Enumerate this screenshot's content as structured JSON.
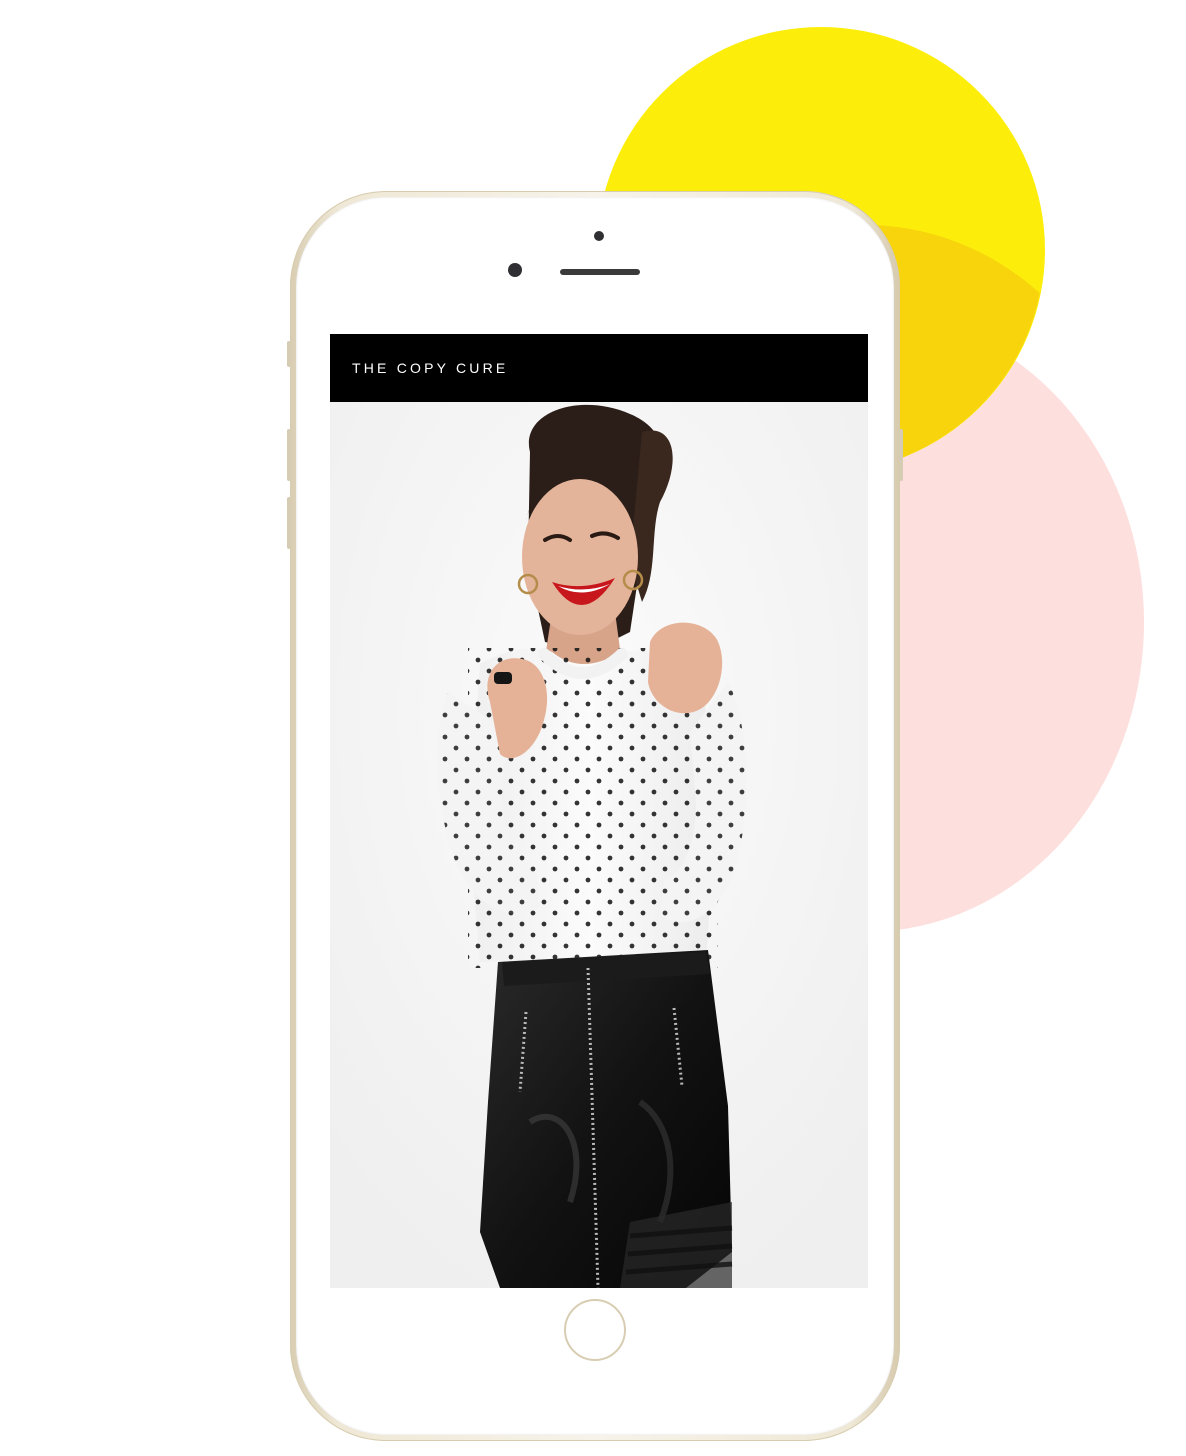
{
  "background": {
    "circles": [
      {
        "name": "yellow",
        "color": "#fcee0a"
      },
      {
        "name": "pink",
        "color": "#fde0de"
      }
    ]
  },
  "phone": {
    "finish_color": "#efe8d6",
    "screen": {
      "header": {
        "brand": "THE COPY CURE",
        "background_color": "#000000",
        "text_color": "#ffffff"
      },
      "hero": {
        "content": "photo-portrait"
      }
    }
  }
}
